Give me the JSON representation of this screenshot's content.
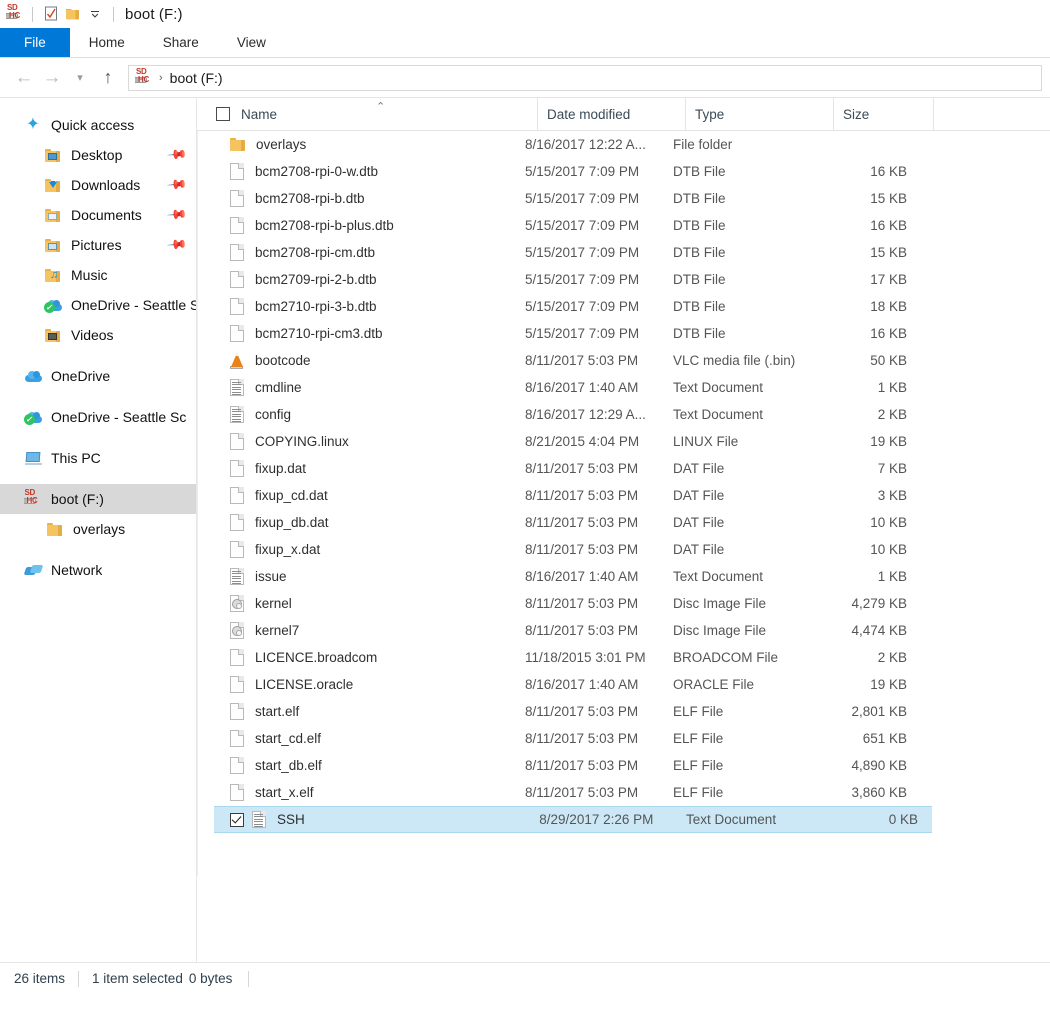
{
  "titlebar": {
    "drive_icon": "sd-card-icon",
    "quick_access_buttons": [
      {
        "name": "properties-icon",
        "glyph": "☑"
      },
      {
        "name": "new-folder-icon",
        "glyph": "📁"
      },
      {
        "name": "customize-qat-chevron-icon",
        "glyph": "⌵"
      }
    ],
    "title": "boot (F:)"
  },
  "ribbon": {
    "tabs": [
      {
        "label": "File",
        "active": true
      },
      {
        "label": "Home",
        "active": false
      },
      {
        "label": "Share",
        "active": false
      },
      {
        "label": "View",
        "active": false
      }
    ]
  },
  "addressbar": {
    "back_icon": "back-arrow-icon",
    "forward_icon": "forward-arrow-icon",
    "recent_icon": "recent-locations-chevron-icon",
    "up_icon": "up-arrow-icon",
    "breadcrumb_icon": "sd-card-icon",
    "breadcrumb_separator": "›",
    "breadcrumb": "boot (F:)"
  },
  "sidebar": {
    "items": [
      {
        "label": "Quick access",
        "icon": "star-icon",
        "indent": 0,
        "pinned": false,
        "selected": false
      },
      {
        "label": "Desktop",
        "icon": "folder-desktop-icon",
        "indent": 1,
        "pinned": true,
        "selected": false
      },
      {
        "label": "Downloads",
        "icon": "folder-downloads-icon",
        "indent": 1,
        "pinned": true,
        "selected": false
      },
      {
        "label": "Documents",
        "icon": "folder-documents-icon",
        "indent": 1,
        "pinned": true,
        "selected": false
      },
      {
        "label": "Pictures",
        "icon": "folder-pictures-icon",
        "indent": 1,
        "pinned": true,
        "selected": false
      },
      {
        "label": "Music",
        "icon": "folder-music-icon",
        "indent": 1,
        "pinned": false,
        "selected": false
      },
      {
        "label": "OneDrive - Seattle S",
        "icon": "onedrive-synced-icon",
        "indent": 1,
        "pinned": false,
        "selected": false
      },
      {
        "label": "Videos",
        "icon": "folder-videos-icon",
        "indent": 1,
        "pinned": false,
        "selected": false
      },
      {
        "label": "OneDrive",
        "icon": "onedrive-icon",
        "indent": 0,
        "pinned": false,
        "selected": false,
        "gap_before": true
      },
      {
        "label": "OneDrive - Seattle Sc",
        "icon": "onedrive-synced-icon",
        "indent": 0,
        "pinned": false,
        "selected": false,
        "gap_before": true
      },
      {
        "label": "This PC",
        "icon": "this-pc-icon",
        "indent": 0,
        "pinned": false,
        "selected": false,
        "gap_before": true
      },
      {
        "label": "boot (F:)",
        "icon": "sd-card-icon",
        "indent": 0,
        "pinned": false,
        "selected": true,
        "gap_before": true
      },
      {
        "label": "overlays",
        "icon": "folder-icon",
        "indent": 2,
        "pinned": false,
        "selected": false
      },
      {
        "label": "Network",
        "icon": "network-icon",
        "indent": 0,
        "pinned": false,
        "selected": false,
        "gap_before": true
      }
    ]
  },
  "filelist": {
    "select_all_checkbox": false,
    "columns": [
      {
        "key": "name",
        "label": "Name",
        "sorted": true,
        "sort_direction": "ascending",
        "sort_glyph": "⌃"
      },
      {
        "key": "date",
        "label": "Date modified",
        "sorted": false
      },
      {
        "key": "type",
        "label": "Type",
        "sorted": false
      },
      {
        "key": "size",
        "label": "Size",
        "sorted": false
      }
    ],
    "rows": [
      {
        "name": "overlays",
        "date": "8/16/2017 12:22 A...",
        "type": "File folder",
        "size": "",
        "icon": "folder-icon",
        "selected": false
      },
      {
        "name": "bcm2708-rpi-0-w.dtb",
        "date": "5/15/2017 7:09 PM",
        "type": "DTB File",
        "size": "16 KB",
        "icon": "generic-file-icon",
        "selected": false
      },
      {
        "name": "bcm2708-rpi-b.dtb",
        "date": "5/15/2017 7:09 PM",
        "type": "DTB File",
        "size": "15 KB",
        "icon": "generic-file-icon",
        "selected": false
      },
      {
        "name": "bcm2708-rpi-b-plus.dtb",
        "date": "5/15/2017 7:09 PM",
        "type": "DTB File",
        "size": "16 KB",
        "icon": "generic-file-icon",
        "selected": false
      },
      {
        "name": "bcm2708-rpi-cm.dtb",
        "date": "5/15/2017 7:09 PM",
        "type": "DTB File",
        "size": "15 KB",
        "icon": "generic-file-icon",
        "selected": false
      },
      {
        "name": "bcm2709-rpi-2-b.dtb",
        "date": "5/15/2017 7:09 PM",
        "type": "DTB File",
        "size": "17 KB",
        "icon": "generic-file-icon",
        "selected": false
      },
      {
        "name": "bcm2710-rpi-3-b.dtb",
        "date": "5/15/2017 7:09 PM",
        "type": "DTB File",
        "size": "18 KB",
        "icon": "generic-file-icon",
        "selected": false
      },
      {
        "name": "bcm2710-rpi-cm3.dtb",
        "date": "5/15/2017 7:09 PM",
        "type": "DTB File",
        "size": "16 KB",
        "icon": "generic-file-icon",
        "selected": false
      },
      {
        "name": "bootcode",
        "date": "8/11/2017 5:03 PM",
        "type": "VLC media file (.bin)",
        "size": "50 KB",
        "icon": "vlc-media-file-icon",
        "selected": false
      },
      {
        "name": "cmdline",
        "date": "8/16/2017 1:40 AM",
        "type": "Text Document",
        "size": "1 KB",
        "icon": "text-document-icon",
        "selected": false
      },
      {
        "name": "config",
        "date": "8/16/2017 12:29 A...",
        "type": "Text Document",
        "size": "2 KB",
        "icon": "text-document-icon",
        "selected": false
      },
      {
        "name": "COPYING.linux",
        "date": "8/21/2015 4:04 PM",
        "type": "LINUX File",
        "size": "19 KB",
        "icon": "generic-file-icon",
        "selected": false
      },
      {
        "name": "fixup.dat",
        "date": "8/11/2017 5:03 PM",
        "type": "DAT File",
        "size": "7 KB",
        "icon": "generic-file-icon",
        "selected": false
      },
      {
        "name": "fixup_cd.dat",
        "date": "8/11/2017 5:03 PM",
        "type": "DAT File",
        "size": "3 KB",
        "icon": "generic-file-icon",
        "selected": false
      },
      {
        "name": "fixup_db.dat",
        "date": "8/11/2017 5:03 PM",
        "type": "DAT File",
        "size": "10 KB",
        "icon": "generic-file-icon",
        "selected": false
      },
      {
        "name": "fixup_x.dat",
        "date": "8/11/2017 5:03 PM",
        "type": "DAT File",
        "size": "10 KB",
        "icon": "generic-file-icon",
        "selected": false
      },
      {
        "name": "issue",
        "date": "8/16/2017 1:40 AM",
        "type": "Text Document",
        "size": "1 KB",
        "icon": "text-document-icon",
        "selected": false
      },
      {
        "name": "kernel",
        "date": "8/11/2017 5:03 PM",
        "type": "Disc Image File",
        "size": "4,279 KB",
        "icon": "disc-image-icon",
        "selected": false
      },
      {
        "name": "kernel7",
        "date": "8/11/2017 5:03 PM",
        "type": "Disc Image File",
        "size": "4,474 KB",
        "icon": "disc-image-icon",
        "selected": false
      },
      {
        "name": "LICENCE.broadcom",
        "date": "11/18/2015 3:01 PM",
        "type": "BROADCOM File",
        "size": "2 KB",
        "icon": "generic-file-icon",
        "selected": false
      },
      {
        "name": "LICENSE.oracle",
        "date": "8/16/2017 1:40 AM",
        "type": "ORACLE File",
        "size": "19 KB",
        "icon": "generic-file-icon",
        "selected": false
      },
      {
        "name": "start.elf",
        "date": "8/11/2017 5:03 PM",
        "type": "ELF File",
        "size": "2,801 KB",
        "icon": "generic-file-icon",
        "selected": false
      },
      {
        "name": "start_cd.elf",
        "date": "8/11/2017 5:03 PM",
        "type": "ELF File",
        "size": "651 KB",
        "icon": "generic-file-icon",
        "selected": false
      },
      {
        "name": "start_db.elf",
        "date": "8/11/2017 5:03 PM",
        "type": "ELF File",
        "size": "4,890 KB",
        "icon": "generic-file-icon",
        "selected": false
      },
      {
        "name": "start_x.elf",
        "date": "8/11/2017 5:03 PM",
        "type": "ELF File",
        "size": "3,860 KB",
        "icon": "generic-file-icon",
        "selected": false
      },
      {
        "name": "SSH",
        "date": "8/29/2017 2:26 PM",
        "type": "Text Document",
        "size": "0 KB",
        "icon": "text-document-icon",
        "selected": true,
        "checked": true
      }
    ]
  },
  "statusbar": {
    "item_count": "26 items",
    "selection_count": "1 item selected",
    "selection_size": "0 bytes"
  },
  "colors": {
    "accent": "#0078d7",
    "selection_fill": "#cce8f7",
    "selection_border": "#a8d8ef",
    "sidebar_selection": "#d8d8d8",
    "folder_yellow": "#f5c460"
  }
}
